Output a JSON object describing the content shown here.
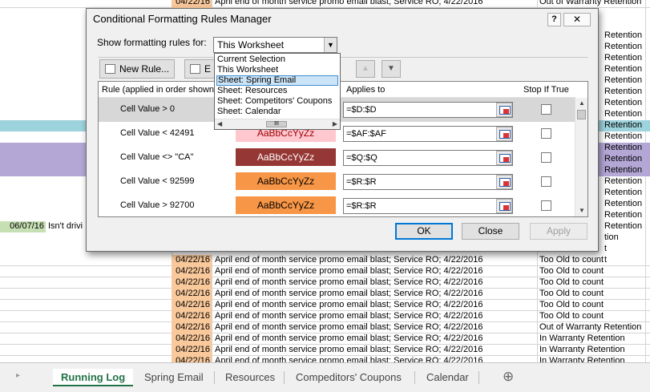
{
  "sheet": {
    "row_text": "April end of month service promo email blast; Service RO; 4/22/2016",
    "date": "04/22/16",
    "side_date": "06/07/16",
    "side_text": "Isn't drivi",
    "rows_top": [
      {
        "date": "04/22/16",
        "text": "April end of month service promo email blast; Service RO; 4/22/2016",
        "right": "Out of Warranty Retention"
      }
    ],
    "right_labels": [
      "Retention",
      "Retention",
      "Retention",
      "Retention",
      "Retention",
      "Retention",
      "Retention",
      "Retention",
      "Retention",
      "Retention",
      "Retention",
      "Retention",
      "Retention",
      "Retention",
      "Retention",
      "Retention",
      "Retention",
      "Retention",
      "tion",
      "t",
      "t"
    ],
    "rows_bottom": [
      {
        "date": "04/22/16",
        "text": "April end of month service promo email blast; Service RO; 4/22/2016",
        "right": "Too Old to count"
      },
      {
        "date": "04/22/16",
        "text": "April end of month service promo email blast; Service RO; 4/22/2016",
        "right": "Too Old to count"
      },
      {
        "date": "04/22/16",
        "text": "April end of month service promo email blast; Service RO; 4/22/2016",
        "right": "Too Old to count"
      },
      {
        "date": "04/22/16",
        "text": "April end of month service promo email blast; Service RO; 4/22/2016",
        "right": "Too Old to count"
      },
      {
        "date": "04/22/16",
        "text": "April end of month service promo email blast; Service RO; 4/22/2016",
        "right": "Too Old to count"
      },
      {
        "date": "04/22/16",
        "text": "April end of month service promo email blast; Service RO; 4/22/2016",
        "right": "Too Old to count"
      },
      {
        "date": "04/22/16",
        "text": "April end of month service promo email blast; Service RO; 4/22/2016",
        "right": "Out of Warranty Retention"
      },
      {
        "date": "04/22/16",
        "text": "April end of month service promo email blast; Service RO; 4/22/2016",
        "right": "In Warranty Retention"
      },
      {
        "date": "04/22/16",
        "text": "April end of month service promo email blast; Service RO; 4/22/2016",
        "right": "In Warranty Retention"
      },
      {
        "date": "04/22/16",
        "text": "April end of month service promo email blast; Service RO; 4/22/2016",
        "right": "In Warranty Retention"
      },
      {
        "date": "04/22/16",
        "text": "April end of month service promo email blast; Service RO; 4/22/2016",
        "right": "In Warranty Retention"
      }
    ]
  },
  "tabs": [
    {
      "label": "Running Log",
      "active": true
    },
    {
      "label": "Spring Email"
    },
    {
      "label": "Resources"
    },
    {
      "label": "Compeditors' Coupons"
    },
    {
      "label": "Calendar"
    }
  ],
  "tab_add_icon": "⊕",
  "dialog": {
    "title": "Conditional Formatting Rules Manager",
    "help": "?",
    "close": "✕",
    "show_label": "Show formatting rules for:",
    "show_value": "This Worksheet",
    "new_rule": "New Rule...",
    "edit_rule_partial": "E",
    "col_rule": "Rule (applied in order shown)",
    "col_format": "Format",
    "col_applies": "Applies to",
    "col_stop": "Stop If True",
    "rules": [
      {
        "name": "Cell Value > 0",
        "preview": "AaBbCcYyZz",
        "applies": "=$D:$D",
        "bg": "#ffc7ce",
        "fg": "#9c0006"
      },
      {
        "name": "Cell Value < 42491",
        "preview": "AaBbCcYyZz",
        "applies": "=$AF:$AF",
        "bg": "#ffc7ce",
        "fg": "#9c0006"
      },
      {
        "name": "Cell Value <> \"CA\"",
        "preview": "AaBbCcYyZz",
        "applies": "=$Q:$Q",
        "bg": "#953734",
        "fg": "#ffffff"
      },
      {
        "name": "Cell Value < 92599",
        "preview": "AaBbCcYyZz",
        "applies": "=$R:$R",
        "bg": "#f79646",
        "fg": "#000000"
      },
      {
        "name": "Cell Value > 92700",
        "preview": "AaBbCcYyZz",
        "applies": "=$R:$R",
        "bg": "#f79646",
        "fg": "#000000"
      }
    ],
    "ok": "OK",
    "close_btn": "Close",
    "apply": "Apply",
    "dropdown": [
      "Current Selection",
      "This Worksheet",
      "Sheet: Spring Email",
      "Sheet: Resources",
      "Sheet: Competitors' Coupons",
      "Sheet: Calendar"
    ],
    "dropdown_highlighted": 2,
    "dropdown_scroll_grip": "III"
  },
  "colors": {
    "date_fill": "#f9c89b",
    "teal_band": "#9dd3dc",
    "purple_band": "#b4a7d6",
    "accent_green": "#217346"
  }
}
